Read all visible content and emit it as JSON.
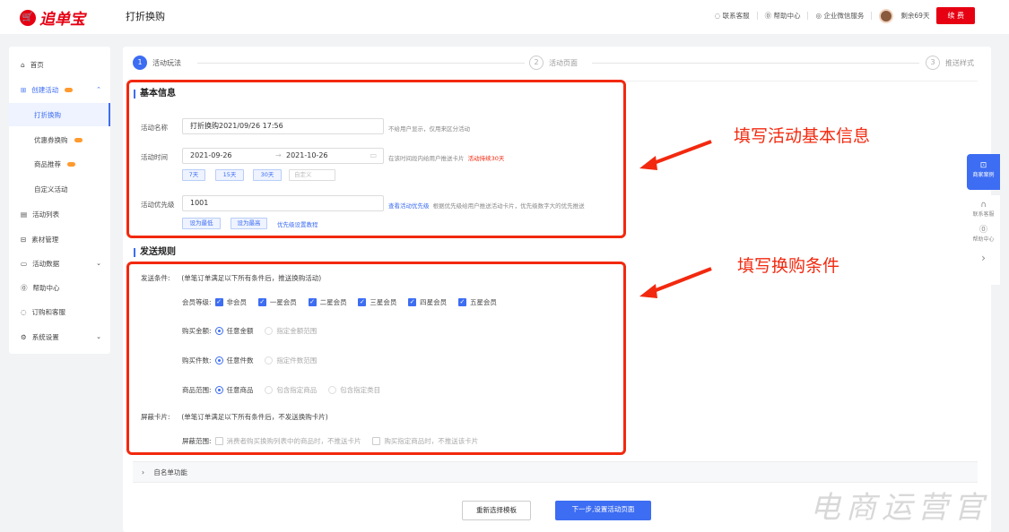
{
  "header": {
    "logo_text": "追单宝",
    "page_title": "打折换购",
    "links": [
      "联系客服",
      "帮助中心",
      "企业微信服务"
    ],
    "remaining": "剩余69天",
    "renew": "续 费"
  },
  "sidebar": {
    "items": [
      {
        "label": "首页"
      },
      {
        "label": "创建活动"
      },
      {
        "label": "打折换购"
      },
      {
        "label": "优惠券换购"
      },
      {
        "label": "商品推荐"
      },
      {
        "label": "自定义活动"
      },
      {
        "label": "活动列表"
      },
      {
        "label": "素材管理"
      },
      {
        "label": "活动数据"
      },
      {
        "label": "帮助中心"
      },
      {
        "label": "订购和客服"
      },
      {
        "label": "系统设置"
      }
    ]
  },
  "steps": [
    {
      "num": "1",
      "label": "活动玩法"
    },
    {
      "num": "2",
      "label": "活动页面"
    },
    {
      "num": "3",
      "label": "推送样式"
    }
  ],
  "basic": {
    "title": "基本信息",
    "name_label": "活动名称",
    "name_value": "打折换购2021/09/26 17:56",
    "name_hint": "不给用户显示，仅用来区分活动",
    "time_label": "活动时间",
    "start": "2021-09-26",
    "arrow": "→",
    "end": "2021-10-26",
    "time_hint": "在该时间段内给用户推送卡片",
    "time_duration": "活动持续30天",
    "quick": [
      "7天",
      "15天",
      "30天"
    ],
    "custom_placeholder": "自定义",
    "priority_label": "活动优先级",
    "priority_value": "1001",
    "priority_link": "查看活动优先级",
    "priority_hint": "根据优先级给用户推送活动卡片，优先级数字大的优先推送",
    "set_lowest": "设为最低",
    "set_highest": "设为最高",
    "priority_tutorial": "优先级设置教程"
  },
  "rules": {
    "title": "发送规则",
    "send_label": "发送条件:",
    "send_desc": "(单笔订单满足以下所有条件后，推送换购活动)",
    "member_label": "会员等级:",
    "members": [
      "非会员",
      "一星会员",
      "二星会员",
      "三星会员",
      "四星会员",
      "五星会员"
    ],
    "amount_label": "购买金额:",
    "amount_options": [
      "任意金额",
      "指定金额范围"
    ],
    "count_label": "购买件数:",
    "count_options": [
      "任意件数",
      "指定件数范围"
    ],
    "scope_label": "商品范围:",
    "scope_options": [
      "任意商品",
      "包含指定商品",
      "包含指定类目"
    ],
    "block_label": "屏蔽卡片:",
    "block_desc": "(单笔订单满足以下所有条件后，不发送换购卡片)",
    "block_scope_label": "屏蔽范围:",
    "block_options": [
      "消费者购买换购列表中的商品时，不推送卡片",
      "购买指定商品时，不推送该卡片"
    ]
  },
  "whitelist": "自名单功能",
  "footer": {
    "reselect": "重新选择模板",
    "next": "下一步,设置活动页面"
  },
  "annotations": [
    "填写活动基本信息",
    "填写换购条件"
  ],
  "float_panel": {
    "cases": "商家案例",
    "service": "联系客服",
    "help": "帮助中心"
  },
  "watermark": "电商运营官",
  "colors": {
    "accent": "#3d6df2",
    "brand": "#e60012",
    "annotation": "#f2290f"
  }
}
